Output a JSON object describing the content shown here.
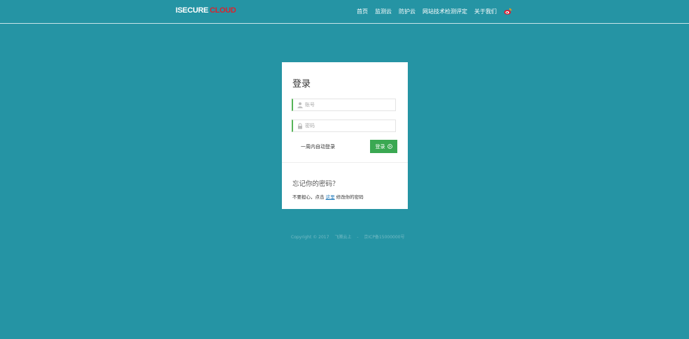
{
  "header": {
    "logo_part1": "ISECURE",
    "logo_part2": "CLOUD",
    "nav": [
      "首页",
      "监测云",
      "防护云",
      "网站技术检测评定",
      "关于我们"
    ],
    "weibo_icon": "weibo-icon"
  },
  "login": {
    "title": "登录",
    "username_placeholder": "账号",
    "password_placeholder": "密码",
    "remember_label": "一周内自动登录",
    "submit_label": "登录",
    "forgot_title": "忘记你的密码？",
    "forgot_prefix": "不要担心，点击",
    "forgot_link": "这里",
    "forgot_suffix": "修改你的密码"
  },
  "footer": {
    "copyright": "Copyright © 2017",
    "company": "飞腾云上",
    "separator": "-",
    "icp": "京ICP备15000000号"
  },
  "colors": {
    "background": "#2594a4",
    "logo_accent": "#d9232e",
    "button": "#3aa852",
    "field_accent": "#57b558",
    "link": "#2a7fbd"
  }
}
